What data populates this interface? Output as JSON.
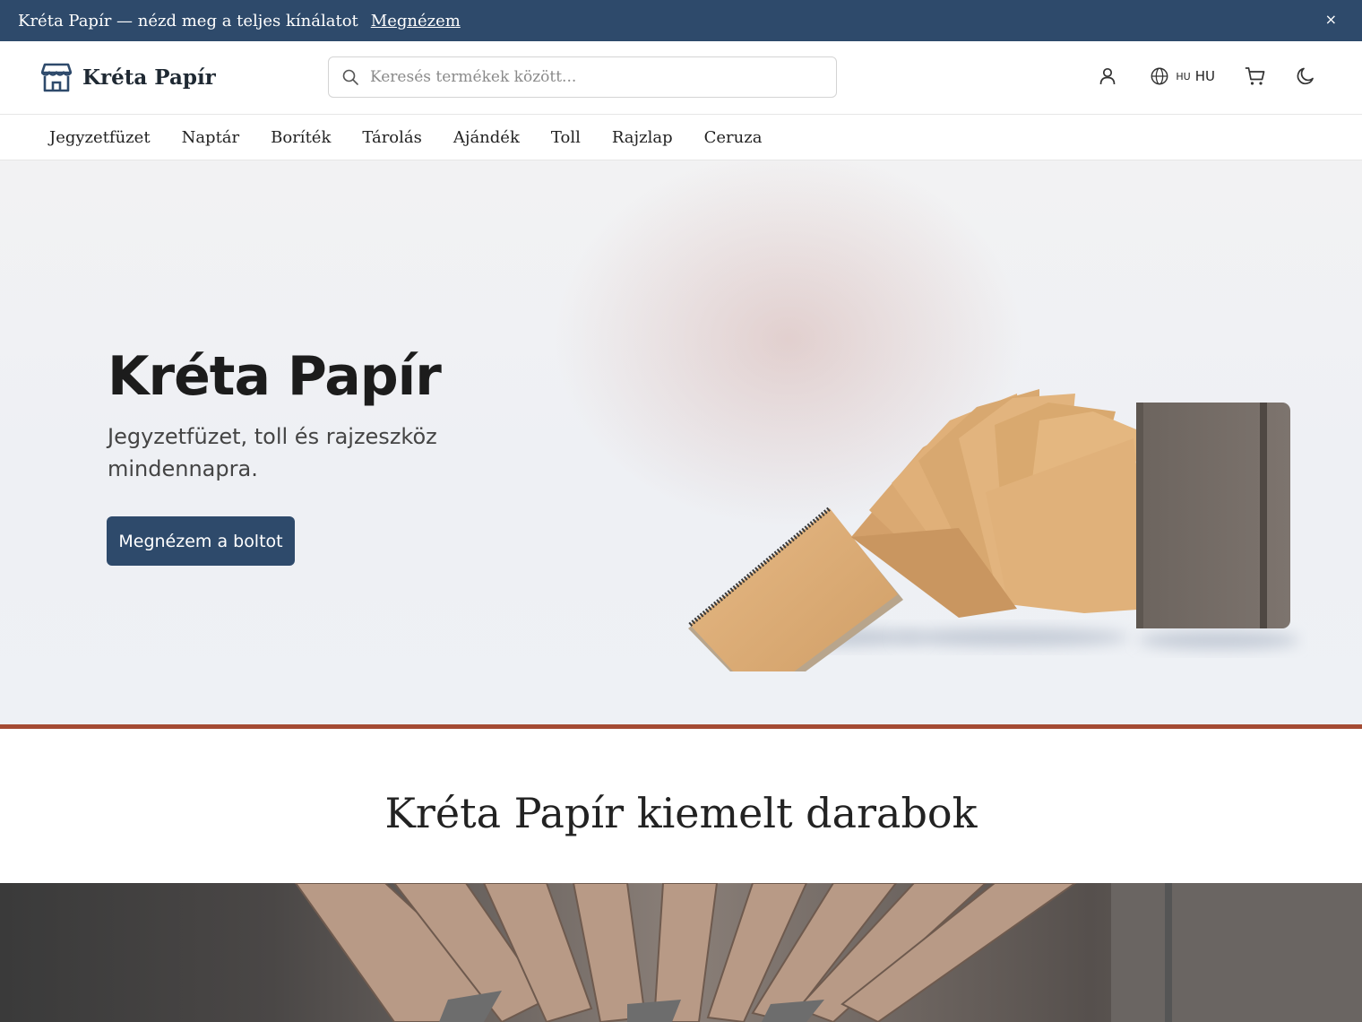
{
  "announcement": {
    "text": "Kréta Papír — nézd meg a teljes kínálatot",
    "link": "Megnézem",
    "close": "×"
  },
  "header": {
    "brand": "Kréta Papír",
    "search_placeholder": "Keresés termékek között...",
    "lang_small": "HU",
    "lang_label": "HU",
    "icons": [
      "store-icon",
      "search-icon",
      "user-icon",
      "globe-icon",
      "cart-icon",
      "moon-icon"
    ]
  },
  "nav": {
    "items": [
      "Jegyzetfüzet",
      "Naptár",
      "Boríték",
      "Tárolás",
      "Ajándék",
      "Toll",
      "Rajzlap",
      "Ceruza"
    ]
  },
  "hero": {
    "title": "Kréta Papír",
    "subtitle": "Jegyzetfüzet, toll és rajzeszköz mindennapra.",
    "cta": "Megnézem a boltot"
  },
  "featured": {
    "title": "Kréta Papír kiemelt darabok"
  },
  "colors": {
    "primary": "#2e4a6b",
    "accent_rule": "#a44b33",
    "kraft": "#d9aa73",
    "notebook": "#756c66"
  }
}
